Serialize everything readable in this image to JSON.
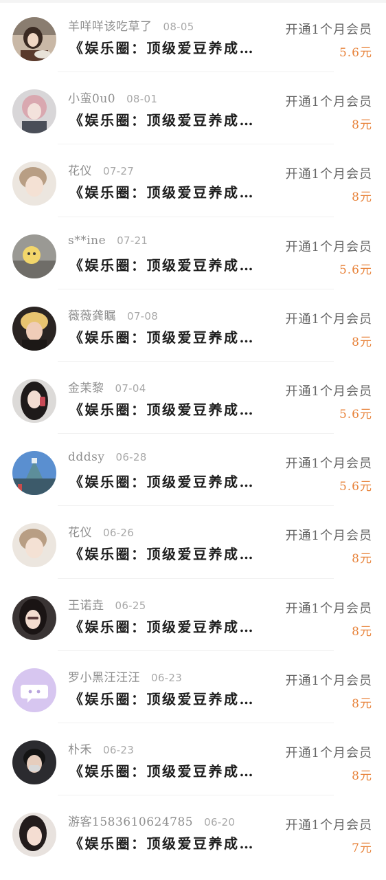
{
  "colors": {
    "background": "#ffffff",
    "name": "#8e8e8e",
    "date": "#a8a8a8",
    "title": "#1e1e1e",
    "action": "#666666",
    "price": "#e8843c",
    "divider": "#f1f1f1"
  },
  "items": [
    {
      "name": "羊咩咩该吃草了",
      "date": "08-05",
      "title": "《娱乐圈：顶级爱豆养成…",
      "action": "开通1个月会员",
      "price": "5.6元",
      "avatar": "photo-avatar"
    },
    {
      "name": "小蛮0u0",
      "date": "08-01",
      "title": "《娱乐圈：顶级爱豆养成…",
      "action": "开通1个月会员",
      "price": "8元",
      "avatar": "photo-avatar"
    },
    {
      "name": "花仪",
      "date": "07-27",
      "title": "《娱乐圈：顶级爱豆养成…",
      "action": "开通1个月会员",
      "price": "8元",
      "avatar": "photo-avatar"
    },
    {
      "name": "s**ine",
      "date": "07-21",
      "title": "《娱乐圈：顶级爱豆养成…",
      "action": "开通1个月会员",
      "price": "5.6元",
      "avatar": "photo-avatar"
    },
    {
      "name": "薇薇龚瞩",
      "date": "07-08",
      "title": "《娱乐圈：顶级爱豆养成…",
      "action": "开通1个月会员",
      "price": "8元",
      "avatar": "photo-avatar"
    },
    {
      "name": "金茉黎",
      "date": "07-04",
      "title": "《娱乐圈：顶级爱豆养成…",
      "action": "开通1个月会员",
      "price": "5.6元",
      "avatar": "photo-avatar"
    },
    {
      "name": "dddsy",
      "date": "06-28",
      "title": "《娱乐圈：顶级爱豆养成…",
      "action": "开通1个月会员",
      "price": "5.6元",
      "avatar": "photo-avatar"
    },
    {
      "name": "花仪",
      "date": "06-26",
      "title": "《娱乐圈：顶级爱豆养成…",
      "action": "开通1个月会员",
      "price": "8元",
      "avatar": "photo-avatar"
    },
    {
      "name": "王诺垚",
      "date": "06-25",
      "title": "《娱乐圈：顶级爱豆养成…",
      "action": "开通1个月会员",
      "price": "8元",
      "avatar": "photo-avatar"
    },
    {
      "name": "罗小黑汪汪汪",
      "date": "06-23",
      "title": "《娱乐圈：顶级爱豆养成…",
      "action": "开通1个月会员",
      "price": "8元",
      "avatar": "chat-bubble-icon"
    },
    {
      "name": "朴禾",
      "date": "06-23",
      "title": "《娱乐圈：顶级爱豆养成…",
      "action": "开通1个月会员",
      "price": "8元",
      "avatar": "photo-avatar"
    },
    {
      "name": "游客1583610624785",
      "date": "06-20",
      "title": "《娱乐圈：顶级爱豆养成…",
      "action": "开通1个月会员",
      "price": "7元",
      "avatar": "photo-avatar"
    }
  ]
}
